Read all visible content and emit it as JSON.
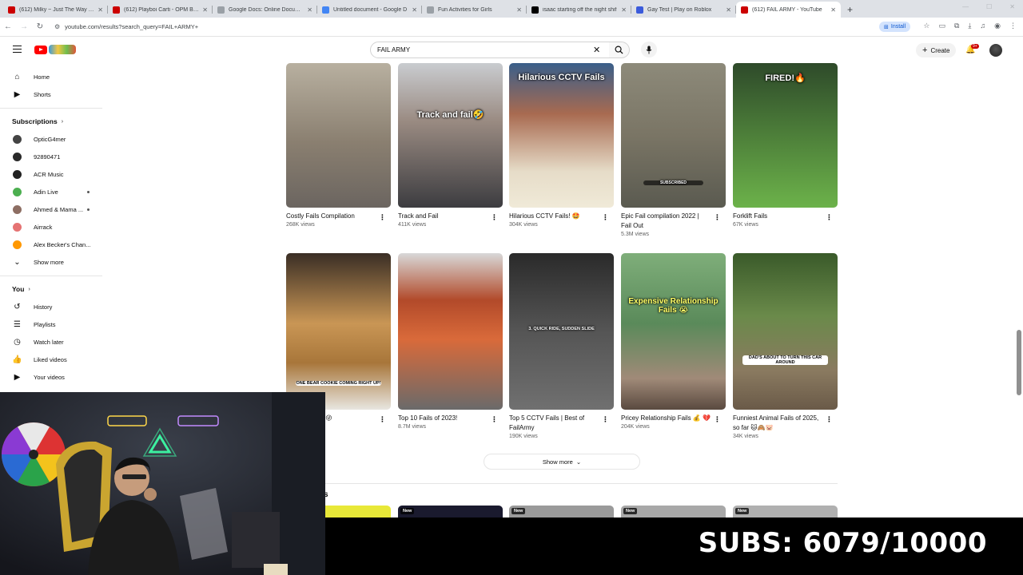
{
  "browser": {
    "tabs": [
      {
        "title": "(612) Milky ~ Just The Way You",
        "color": "#cc0000",
        "active": false
      },
      {
        "title": "(612) Playboi Carti - OPM BAB",
        "color": "#cc0000",
        "active": false
      },
      {
        "title": "Google Docs: Online Document",
        "color": "#9aa0a6",
        "active": false
      },
      {
        "title": "Untitled document - Google D",
        "color": "#4285f4",
        "active": false
      },
      {
        "title": "Fun Activities for Girls",
        "color": "#9aa0a6",
        "active": false
      },
      {
        "title": "isaac starting off the night shif",
        "color": "#000000",
        "active": false
      },
      {
        "title": "Gay Test | Play on Roblox",
        "color": "#3b5bdb",
        "active": false
      },
      {
        "title": "(612) FAIL ARMY - YouTube",
        "color": "#cc0000",
        "active": true
      }
    ],
    "url": "youtube.com/results?search_query=FAIL+ARMY+",
    "install_label": "Install"
  },
  "header": {
    "search_value": "FAIL ARMY",
    "create_label": "Create",
    "notif_count": "9+"
  },
  "sidebar": {
    "top": [
      {
        "label": "Home",
        "icon": "home-icon",
        "glyph": "⌂"
      },
      {
        "label": "Shorts",
        "icon": "shorts-icon",
        "glyph": "▶"
      }
    ],
    "subscriptions_label": "Subscriptions",
    "subscriptions": [
      {
        "label": "OpticG4mer",
        "color": "#444444",
        "live": false
      },
      {
        "label": "92890471",
        "color": "#2a2a2a",
        "live": false
      },
      {
        "label": "ACR Music",
        "color": "#222222",
        "live": false
      },
      {
        "label": "Adin Live",
        "color": "#4caf50",
        "live": true
      },
      {
        "label": "Ahmed & Mama ...",
        "color": "#8d6e63",
        "live": true
      },
      {
        "label": "Airrack",
        "color": "#e57373",
        "live": false
      },
      {
        "label": "Alex Becker's Chan...",
        "color": "#ff9800",
        "live": false
      }
    ],
    "show_more_label": "Show more",
    "you_label": "You",
    "you_items": [
      {
        "label": "History",
        "icon": "history-icon",
        "glyph": "↺"
      },
      {
        "label": "Playlists",
        "icon": "playlists-icon",
        "glyph": "☰"
      },
      {
        "label": "Watch later",
        "icon": "clock-icon",
        "glyph": "◷"
      },
      {
        "label": "Liked videos",
        "icon": "thumbs-up-icon",
        "glyph": "👍"
      },
      {
        "label": "Your videos",
        "icon": "video-icon",
        "glyph": "▶"
      }
    ]
  },
  "videos_row1": [
    {
      "title": "Costly Fails Compilation",
      "views": "268K views",
      "overlay": "",
      "bg": "linear-gradient(180deg,#b8b0a0 0%,#8a7f70 55%,#6b6560 100%)"
    },
    {
      "title": "Track and Fail",
      "views": "411K views",
      "overlay": "Track and fail🤣",
      "bg": "linear-gradient(180deg,#c9ccd0 0%,#9a8b82 40%,#3c3c40 100%)"
    },
    {
      "title": "Hilarious CCTV Fails! 🤩",
      "views": "304K views",
      "overlay": "Hilarious CCTV Fails",
      "bg": "linear-gradient(180deg,#3a5f8a 0%,#a86a50 35%,#e6dcc8 75%,#f0ead8 100%)"
    },
    {
      "title": "Epic Fail compilation 2022 | Fail Out",
      "views": "5.3M views",
      "overlay": "SUBSCRIBED",
      "bg": "linear-gradient(180deg,#8d8a7a 0%,#7a7565 50%,#5a5a50 100%)"
    },
    {
      "title": "Forklift Fails",
      "views": "67K views",
      "overlay": "FIRED!🔥",
      "bg": "linear-gradient(180deg,#2e4a2a 0%,#4a7a38 45%,#6cb24a 100%)"
    }
  ],
  "videos_row2": [
    {
      "title": "...with food 😝😜",
      "views": "",
      "overlay": "ONE BEAR COOKIE COMING RIGHT UP!",
      "bg": "linear-gradient(180deg,#3a2e25 0%,#c99655 45%,#a8763a 70%,#e8e6e0 100%)"
    },
    {
      "title": "Top 10 Fails of 2023!",
      "views": "8.7M views",
      "overlay": "",
      "bg": "linear-gradient(180deg,#d8d8d8 0%,#b24a2a 30%,#d96a3a 55%,#6a6a6a 100%)"
    },
    {
      "title": "Top 5 CCTV Fails | Best of FailArmy",
      "views": "190K views",
      "overlay": "3. QUICK RIDE, SUDDEN SLIDE",
      "bg": "linear-gradient(180deg,#2a2a2a 0%,#555555 50%,#707070 100%)"
    },
    {
      "title": "Pricey Relationship Fails 💰 💔",
      "views": "204K views",
      "overlay": "Expensive Relationship Fails 😭",
      "bg": "linear-gradient(180deg,#7fae7a 0%,#5a8a5a 45%,#a08a78 80%,#5a4a40 100%)"
    },
    {
      "title": "Funniest Animal Fails of 2025, so far 🐱🙈🐷",
      "views": "34K views",
      "overlay": "DAD'S ABOUT TO TURN THIS CAR AROUND",
      "bg": "linear-gradient(180deg,#3a5a2a 0%,#6a8a4a 40%,#8a7a60 75%,#6a5a48 100%)"
    }
  ],
  "show_more_label": "Show more",
  "section_partial_label": "s",
  "next_row": [
    {
      "badge": "",
      "bg": "#e8e838"
    },
    {
      "badge": "New",
      "bg": "#1a1a2e"
    },
    {
      "badge": "New",
      "bg": "#9a9a9a"
    },
    {
      "badge": "New",
      "bg": "#a8a8a8"
    },
    {
      "badge": "New",
      "bg": "#b0b0b0"
    }
  ],
  "stream_overlay": {
    "subs_text": "SUBS: 6079/10000"
  }
}
